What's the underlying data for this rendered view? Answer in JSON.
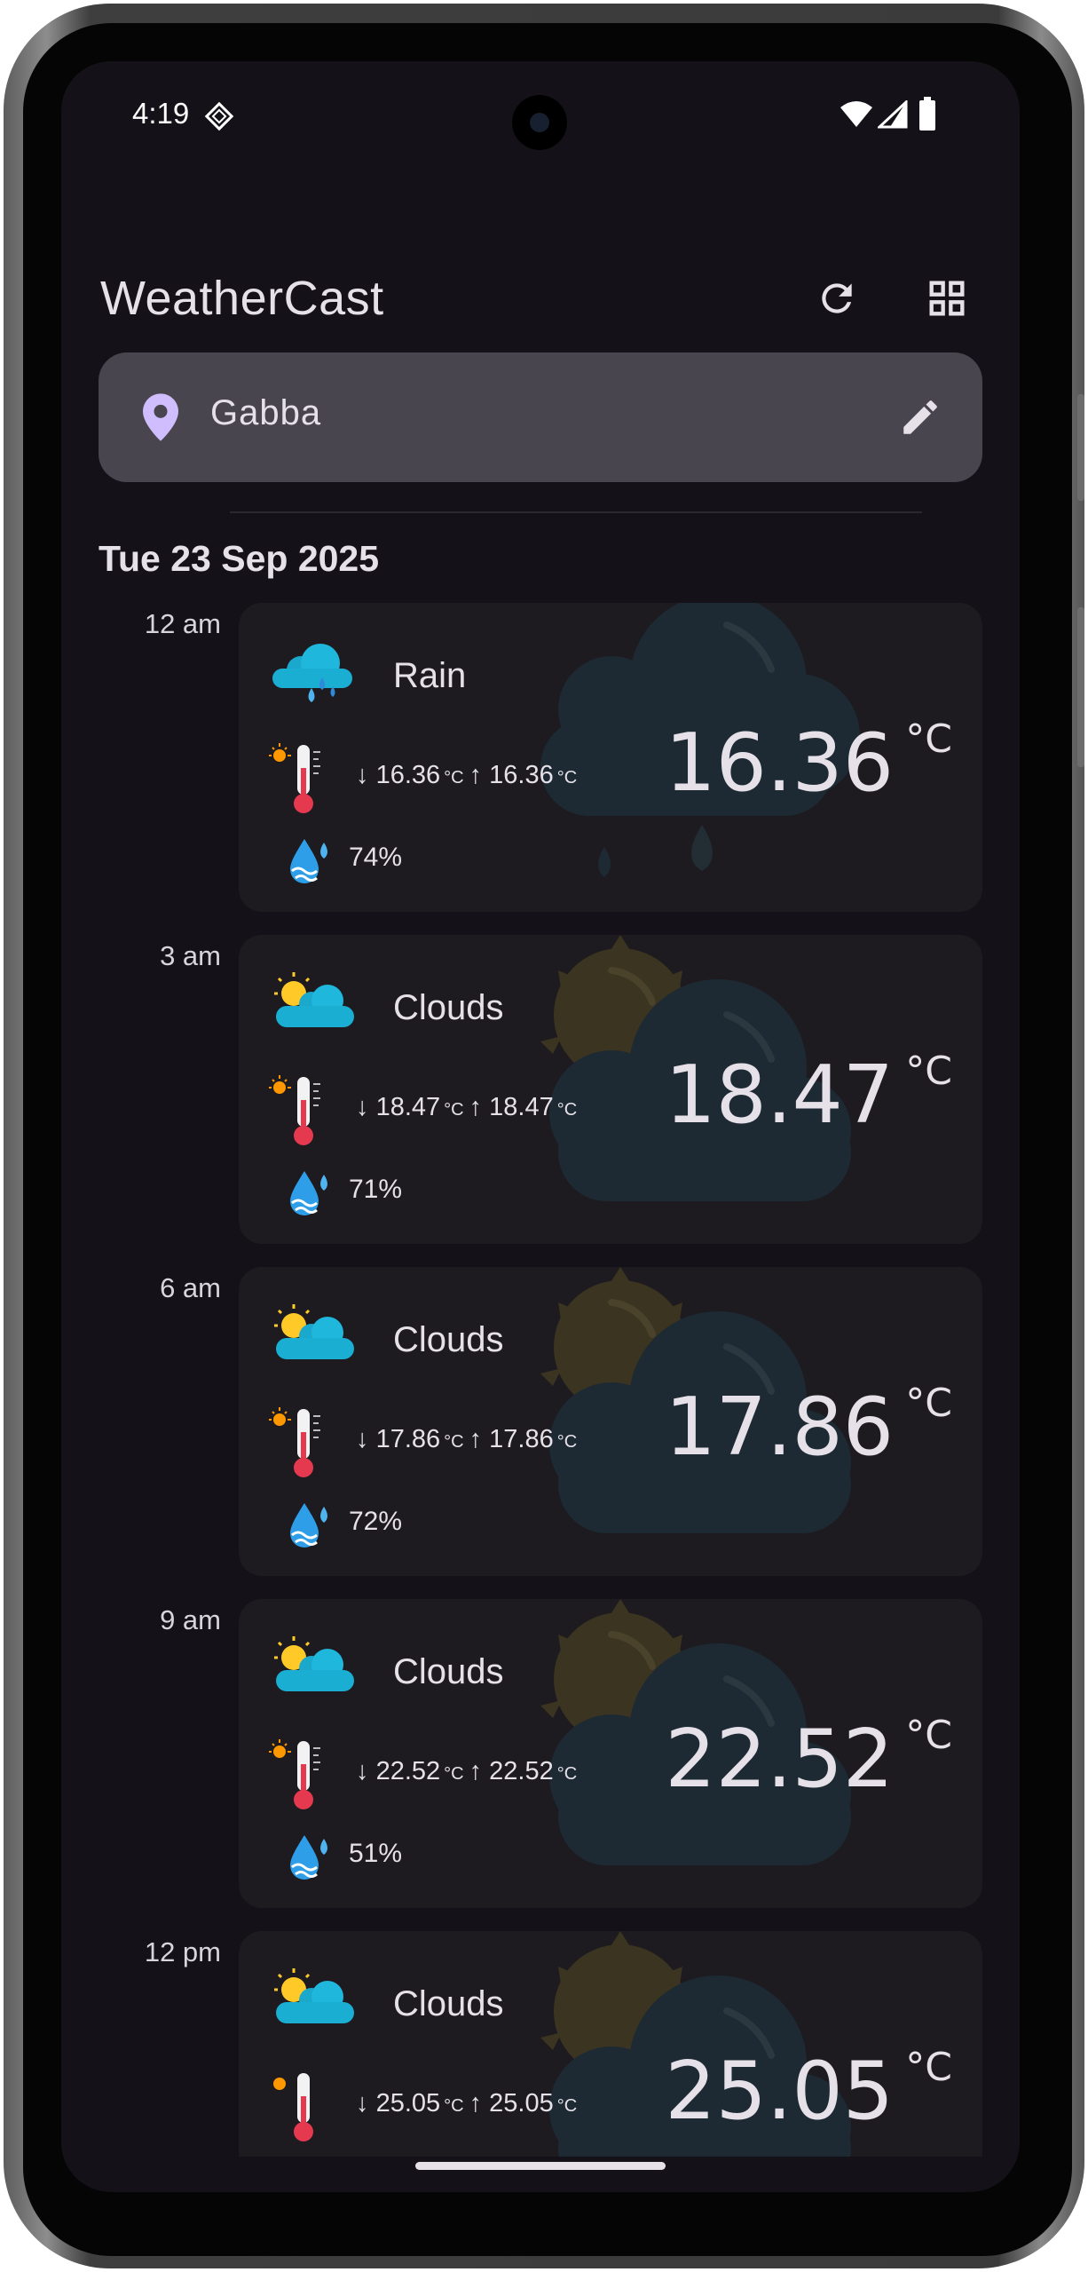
{
  "status_bar": {
    "time": "4:19"
  },
  "app_bar": {
    "title": "WeatherCast",
    "refresh_icon": "refresh-icon",
    "grid_icon": "grid-view-icon"
  },
  "location": {
    "value": "Gabba",
    "pin_icon": "location-pin-icon",
    "edit_icon": "edit-icon"
  },
  "date_header": "Tue 23 Sep 2025",
  "units": {
    "temp": "°C"
  },
  "forecast": [
    {
      "time": "12 am",
      "condition": "Rain",
      "icon": "rain-cloud-icon",
      "min": "16.36",
      "max": "16.36",
      "temp": "16.36",
      "humidity": "74%"
    },
    {
      "time": "3 am",
      "condition": "Clouds",
      "icon": "sun-behind-cloud-icon",
      "min": "18.47",
      "max": "18.47",
      "temp": "18.47",
      "humidity": "71%"
    },
    {
      "time": "6 am",
      "condition": "Clouds",
      "icon": "sun-behind-cloud-icon",
      "min": "17.86",
      "max": "17.86",
      "temp": "17.86",
      "humidity": "72%"
    },
    {
      "time": "9 am",
      "condition": "Clouds",
      "icon": "sun-behind-cloud-icon",
      "min": "22.52",
      "max": "22.52",
      "temp": "22.52",
      "humidity": "51%"
    },
    {
      "time": "12 pm",
      "condition": "Clouds",
      "icon": "sun-behind-cloud-icon",
      "min": "25.05",
      "max": "25.05",
      "temp": "25.05",
      "humidity": ""
    }
  ],
  "colors": {
    "background": "#141218",
    "card": "#1d1b20",
    "search_field": "#49454f",
    "accent_pin": "#cfbdfe",
    "cloud_blue": "#17b3d6",
    "sun_yellow": "#ffc928"
  }
}
